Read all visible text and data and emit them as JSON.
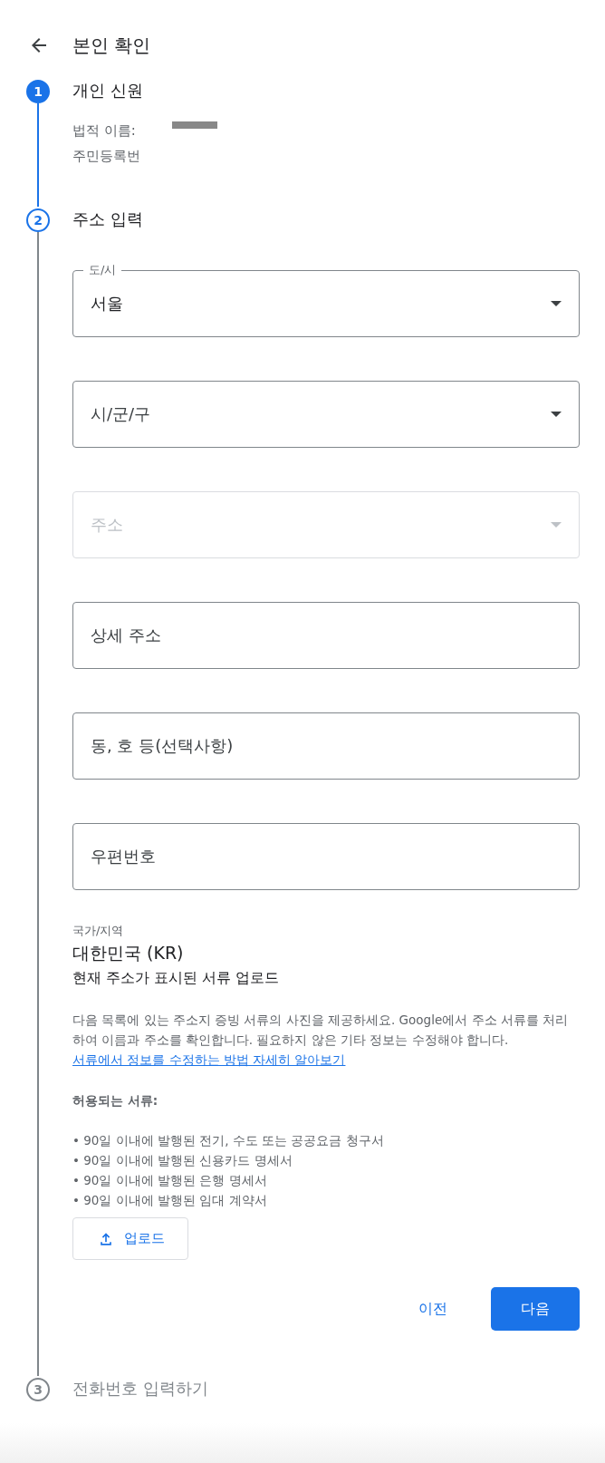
{
  "header": {
    "title": "본인 확인"
  },
  "steps": [
    {
      "number": "1",
      "title": "개인 신원",
      "completed": true,
      "selected": false,
      "details": [
        {
          "label": "법적 이름:",
          "redacted": true
        },
        {
          "label": "주민등록번"
        }
      ]
    },
    {
      "number": "2",
      "title": "주소 입력",
      "completed": false,
      "selected": true,
      "fields": [
        {
          "kind": "select",
          "label": "도/시",
          "value": "서울",
          "disabled": false
        },
        {
          "kind": "select",
          "placeholder": "시/군/구",
          "disabled": false
        },
        {
          "kind": "select",
          "placeholder": "주소",
          "disabled": true
        },
        {
          "kind": "text",
          "placeholder": "상세 주소",
          "disabled": false
        },
        {
          "kind": "text",
          "placeholder": "동, 호 등(선택사항)",
          "disabled": false
        },
        {
          "kind": "text",
          "placeholder": "우편번호",
          "disabled": false
        }
      ],
      "country": {
        "label": "국가/지역",
        "value": "대한민국 (KR)"
      },
      "upload_title": "현재 주소가 표시된 서류 업로드",
      "description": "다음 목록에 있는 주소지 증빙 서류의 사진을 제공하세요. Google에서 주소 서류를 처리하여 이름과 주소를 확인합니다. 필요하지 않은 기타 정보는 수정해야 합니다. ",
      "link": "서류에서 정보를 수정하는 방법 자세히 알아보기",
      "accepted_title": "허용되는 서류:",
      "accepted": [
        "• 90일 이내에 발행된 전기, 수도 또는 공공요금 청구서",
        "• 90일 이내에 발행된 신용카드 명세서",
        "• 90일 이내에 발행된 은행 명세서",
        "• 90일 이내에 발행된 임대 계약서"
      ],
      "upload_button": "업로드",
      "back_button": "이전",
      "next_button": "다음"
    },
    {
      "number": "3",
      "title": "전화번호 입력하기",
      "completed": false,
      "selected": false
    }
  ]
}
